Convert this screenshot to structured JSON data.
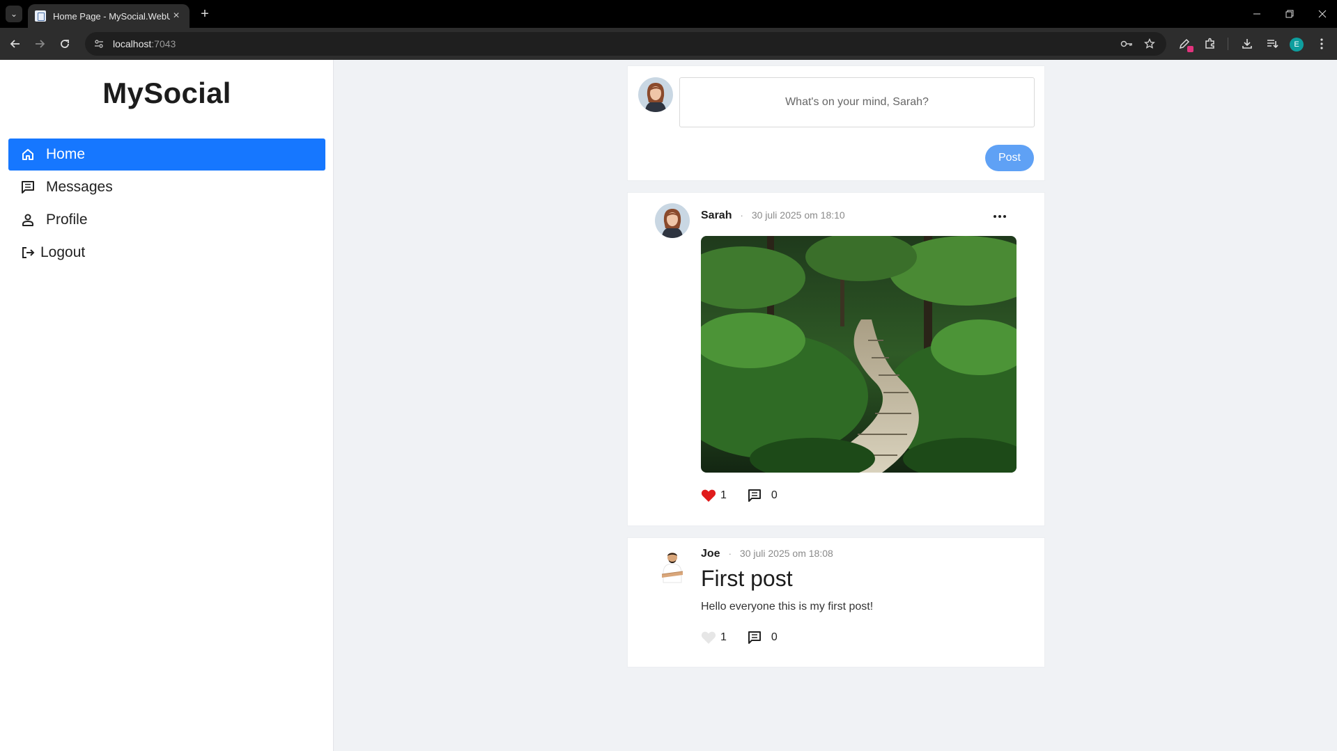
{
  "browser": {
    "tab_title": "Home Page - MySocial.WebUI",
    "tab_close": "×",
    "new_tab": "+",
    "url_host": "localhost",
    "url_port": ":7043",
    "profile_initial": "E"
  },
  "app": {
    "brand": "MySocial",
    "nav": [
      {
        "label": "Home",
        "icon": "home-icon",
        "active": true
      },
      {
        "label": "Messages",
        "icon": "message-icon",
        "active": false
      },
      {
        "label": "Profile",
        "icon": "user-icon",
        "active": false
      },
      {
        "label": "Logout",
        "icon": "logout-icon",
        "active": false
      }
    ],
    "accent_color": "#1677ff"
  },
  "composer": {
    "placeholder": "What's on your mind, Sarah?",
    "post_button": "Post"
  },
  "posts": [
    {
      "author": "Sarah",
      "separator": "·",
      "timestamp": "30 juli 2025 om 18:10",
      "image": "forest-boardwalk-photo",
      "liked": true,
      "likes": "1",
      "comments": "0"
    },
    {
      "author": "Joe",
      "separator": "·",
      "timestamp": "30 juli 2025 om 18:08",
      "title": "First post",
      "body": "Hello everyone this is my first post!",
      "liked": false,
      "likes": "1",
      "comments": "0"
    }
  ]
}
